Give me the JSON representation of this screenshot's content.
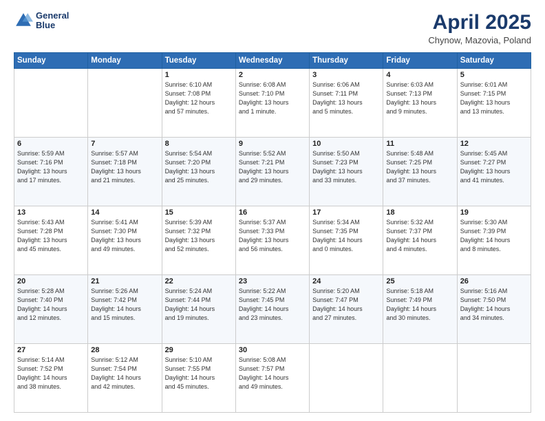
{
  "header": {
    "logo_line1": "General",
    "logo_line2": "Blue",
    "title": "April 2025",
    "location": "Chynow, Mazovia, Poland"
  },
  "days_of_week": [
    "Sunday",
    "Monday",
    "Tuesday",
    "Wednesday",
    "Thursday",
    "Friday",
    "Saturday"
  ],
  "weeks": [
    [
      {
        "day": "",
        "info": ""
      },
      {
        "day": "",
        "info": ""
      },
      {
        "day": "1",
        "info": "Sunrise: 6:10 AM\nSunset: 7:08 PM\nDaylight: 12 hours\nand 57 minutes."
      },
      {
        "day": "2",
        "info": "Sunrise: 6:08 AM\nSunset: 7:10 PM\nDaylight: 13 hours\nand 1 minute."
      },
      {
        "day": "3",
        "info": "Sunrise: 6:06 AM\nSunset: 7:11 PM\nDaylight: 13 hours\nand 5 minutes."
      },
      {
        "day": "4",
        "info": "Sunrise: 6:03 AM\nSunset: 7:13 PM\nDaylight: 13 hours\nand 9 minutes."
      },
      {
        "day": "5",
        "info": "Sunrise: 6:01 AM\nSunset: 7:15 PM\nDaylight: 13 hours\nand 13 minutes."
      }
    ],
    [
      {
        "day": "6",
        "info": "Sunrise: 5:59 AM\nSunset: 7:16 PM\nDaylight: 13 hours\nand 17 minutes."
      },
      {
        "day": "7",
        "info": "Sunrise: 5:57 AM\nSunset: 7:18 PM\nDaylight: 13 hours\nand 21 minutes."
      },
      {
        "day": "8",
        "info": "Sunrise: 5:54 AM\nSunset: 7:20 PM\nDaylight: 13 hours\nand 25 minutes."
      },
      {
        "day": "9",
        "info": "Sunrise: 5:52 AM\nSunset: 7:21 PM\nDaylight: 13 hours\nand 29 minutes."
      },
      {
        "day": "10",
        "info": "Sunrise: 5:50 AM\nSunset: 7:23 PM\nDaylight: 13 hours\nand 33 minutes."
      },
      {
        "day": "11",
        "info": "Sunrise: 5:48 AM\nSunset: 7:25 PM\nDaylight: 13 hours\nand 37 minutes."
      },
      {
        "day": "12",
        "info": "Sunrise: 5:45 AM\nSunset: 7:27 PM\nDaylight: 13 hours\nand 41 minutes."
      }
    ],
    [
      {
        "day": "13",
        "info": "Sunrise: 5:43 AM\nSunset: 7:28 PM\nDaylight: 13 hours\nand 45 minutes."
      },
      {
        "day": "14",
        "info": "Sunrise: 5:41 AM\nSunset: 7:30 PM\nDaylight: 13 hours\nand 49 minutes."
      },
      {
        "day": "15",
        "info": "Sunrise: 5:39 AM\nSunset: 7:32 PM\nDaylight: 13 hours\nand 52 minutes."
      },
      {
        "day": "16",
        "info": "Sunrise: 5:37 AM\nSunset: 7:33 PM\nDaylight: 13 hours\nand 56 minutes."
      },
      {
        "day": "17",
        "info": "Sunrise: 5:34 AM\nSunset: 7:35 PM\nDaylight: 14 hours\nand 0 minutes."
      },
      {
        "day": "18",
        "info": "Sunrise: 5:32 AM\nSunset: 7:37 PM\nDaylight: 14 hours\nand 4 minutes."
      },
      {
        "day": "19",
        "info": "Sunrise: 5:30 AM\nSunset: 7:39 PM\nDaylight: 14 hours\nand 8 minutes."
      }
    ],
    [
      {
        "day": "20",
        "info": "Sunrise: 5:28 AM\nSunset: 7:40 PM\nDaylight: 14 hours\nand 12 minutes."
      },
      {
        "day": "21",
        "info": "Sunrise: 5:26 AM\nSunset: 7:42 PM\nDaylight: 14 hours\nand 15 minutes."
      },
      {
        "day": "22",
        "info": "Sunrise: 5:24 AM\nSunset: 7:44 PM\nDaylight: 14 hours\nand 19 minutes."
      },
      {
        "day": "23",
        "info": "Sunrise: 5:22 AM\nSunset: 7:45 PM\nDaylight: 14 hours\nand 23 minutes."
      },
      {
        "day": "24",
        "info": "Sunrise: 5:20 AM\nSunset: 7:47 PM\nDaylight: 14 hours\nand 27 minutes."
      },
      {
        "day": "25",
        "info": "Sunrise: 5:18 AM\nSunset: 7:49 PM\nDaylight: 14 hours\nand 30 minutes."
      },
      {
        "day": "26",
        "info": "Sunrise: 5:16 AM\nSunset: 7:50 PM\nDaylight: 14 hours\nand 34 minutes."
      }
    ],
    [
      {
        "day": "27",
        "info": "Sunrise: 5:14 AM\nSunset: 7:52 PM\nDaylight: 14 hours\nand 38 minutes."
      },
      {
        "day": "28",
        "info": "Sunrise: 5:12 AM\nSunset: 7:54 PM\nDaylight: 14 hours\nand 42 minutes."
      },
      {
        "day": "29",
        "info": "Sunrise: 5:10 AM\nSunset: 7:55 PM\nDaylight: 14 hours\nand 45 minutes."
      },
      {
        "day": "30",
        "info": "Sunrise: 5:08 AM\nSunset: 7:57 PM\nDaylight: 14 hours\nand 49 minutes."
      },
      {
        "day": "",
        "info": ""
      },
      {
        "day": "",
        "info": ""
      },
      {
        "day": "",
        "info": ""
      }
    ]
  ]
}
